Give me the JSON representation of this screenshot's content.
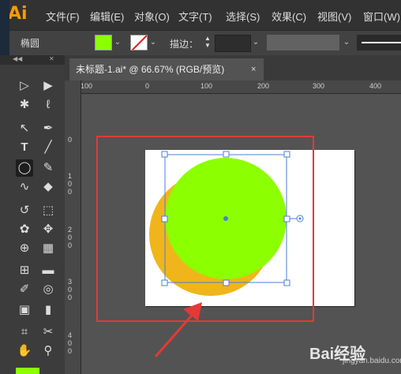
{
  "app": {
    "logo": "Ai"
  },
  "menu": [
    "文件(F)",
    "编辑(E)",
    "对象(O)",
    "文字(T)",
    "选择(S)",
    "效果(C)",
    "视图(V)",
    "窗口(W)"
  ],
  "control": {
    "tool_name": "椭圆",
    "fill_color": "#8cff00",
    "stroke_label": "描边：",
    "stroke_value": ""
  },
  "document_tab": {
    "title": "未标题-1.ai* @ 66.67% (RGB/预览)",
    "close": "×"
  },
  "ruler": {
    "h_ticks": [
      "100",
      "0",
      "100",
      "200",
      "300",
      "400"
    ],
    "v_ticks": [
      "0",
      "1\n0\n0",
      "2\n0\n0",
      "3\n0\n0",
      "4\n0\n0"
    ]
  },
  "canvas": {
    "back_circle_color": "#f0b51a",
    "front_circle_color": "#8cff00",
    "selection_color": "#4a7fd8",
    "highlight_color": "#e53935"
  },
  "watermark": {
    "text": "Bai经验",
    "sub": "jingyan.baidu.com"
  }
}
